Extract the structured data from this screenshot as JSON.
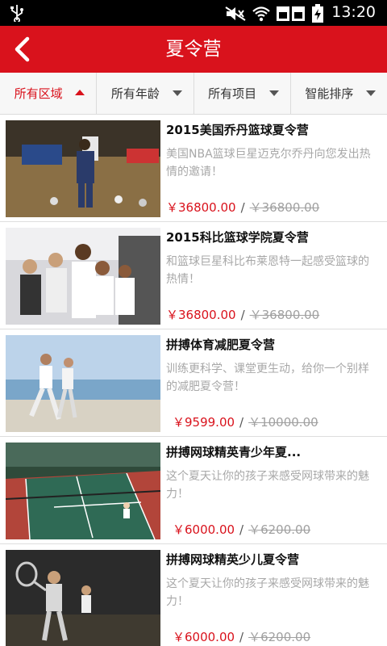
{
  "status_bar": {
    "time": "13:20"
  },
  "header": {
    "title": "夏令营"
  },
  "filters": [
    {
      "label": "所有区域",
      "active": true
    },
    {
      "label": "所有年龄",
      "active": false
    },
    {
      "label": "所有项目",
      "active": false
    },
    {
      "label": "智能排序",
      "active": false
    }
  ],
  "items": [
    {
      "title": "2015美国乔丹篮球夏令营",
      "desc": "美国NBA篮球巨星迈克尔乔丹向您发出热情的邀请！",
      "price": "￥36800.00",
      "sep": "/",
      "old_price": "￥36800.00"
    },
    {
      "title": "2015科比篮球学院夏令营",
      "desc": "和篮球巨星科比布莱恩特一起感受篮球的热情！",
      "price": "￥36800.00",
      "sep": "/",
      "old_price": "￥36800.00"
    },
    {
      "title": "拼搏体育减肥夏令营",
      "desc": "训练更科学、课堂更生动，给你一个别样的减肥夏令营！",
      "price": "￥9599.00",
      "sep": "/",
      "old_price": "￥10000.00"
    },
    {
      "title": "拼搏网球精英青少年夏...",
      "desc": "这个夏天让你的孩子来感受网球带来的魅力！",
      "price": "￥6000.00",
      "sep": "/",
      "old_price": "￥6200.00"
    },
    {
      "title": "拼搏网球精英少儿夏令营",
      "desc": "这个夏天让你的孩子来感受网球带来的魅力！",
      "price": "￥6000.00",
      "sep": "/",
      "old_price": "￥6200.00"
    }
  ],
  "icons": {
    "status": [
      "usb-icon",
      "mute-icon",
      "wifi-icon",
      "sim-icon",
      "battery-charging-icon"
    ],
    "back": "back-arrow-icon"
  },
  "colors": {
    "brand_red": "#d9121c",
    "status_bg": "#000000",
    "muted_text": "#a8a8a8"
  }
}
